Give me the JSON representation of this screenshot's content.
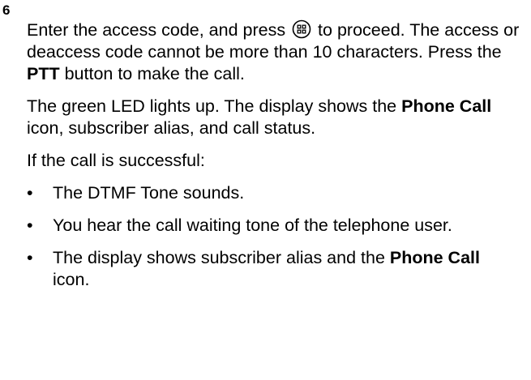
{
  "step": {
    "number": "6"
  },
  "paragraph1": {
    "before_icon": "Enter the access code, and press ",
    "icon": "menu-ok-button-icon",
    "after_icon": " to proceed. The access or deaccess code cannot be more than 10 characters. Press the ",
    "bold": "PTT",
    "after_bold": " button to make the call."
  },
  "paragraph2": {
    "before_bold1": "The green LED lights up. The display shows the ",
    "bold1": "Phone Call",
    "after_bold1": " icon, subscriber alias, and call status."
  },
  "paragraph3": {
    "text": "If the call is successful:"
  },
  "bullets": [
    {
      "marker": "•",
      "text": "The DTMF Tone sounds."
    },
    {
      "marker": "•",
      "text": "You hear the call waiting tone of the telephone user."
    },
    {
      "marker": "•",
      "before_bold": "The display shows subscriber alias and the ",
      "bold": "Phone Call",
      "after_bold": " icon."
    }
  ]
}
